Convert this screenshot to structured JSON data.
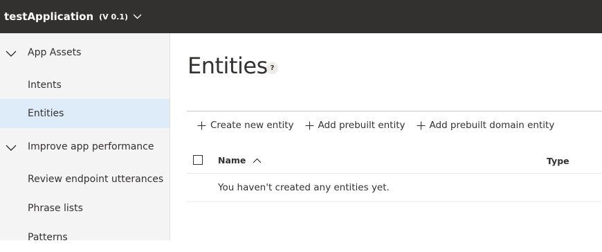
{
  "app": {
    "name": "testApplication",
    "version": "(V 0.1)"
  },
  "sidebar": {
    "groups": [
      {
        "label": "App Assets",
        "items": [
          {
            "label": "Intents"
          },
          {
            "label": "Entities"
          }
        ]
      },
      {
        "label": "Improve app performance",
        "items": [
          {
            "label": "Review endpoint utterances"
          },
          {
            "label": "Phrase lists"
          },
          {
            "label": "Patterns"
          }
        ]
      }
    ],
    "selected_item": "Entities"
  },
  "main": {
    "title": "Entities",
    "help_glyph": "?",
    "commands": [
      {
        "label": "Create new entity",
        "icon": "plus-icon"
      },
      {
        "label": "Add prebuilt entity",
        "icon": "plus-icon"
      },
      {
        "label": "Add prebuilt domain entity",
        "icon": "plus-icon"
      }
    ],
    "grid": {
      "columns": [
        {
          "label": "Name",
          "sort": "ascending"
        },
        {
          "label": "Type"
        }
      ],
      "empty_message": "You haven't created any entities yet."
    }
  },
  "colors": {
    "topbar": "#323130",
    "sidebar": "#f4f4f4",
    "selected": "#deecf9",
    "text": "#323130"
  }
}
